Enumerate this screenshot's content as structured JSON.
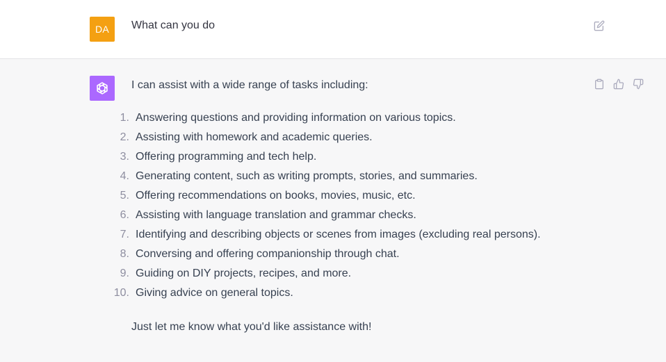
{
  "user_message": {
    "avatar_initials": "DA",
    "avatar_color": "#f4a012",
    "text": "What can you do",
    "edit_icon": "edit-icon"
  },
  "assistant_message": {
    "avatar_color": "#ab68ff",
    "avatar_icon": "openai-logo-icon",
    "intro": "I can assist with a wide range of tasks including:",
    "items": [
      {
        "number": "1.",
        "text": "Answering questions and providing information on various topics."
      },
      {
        "number": "2.",
        "text": "Assisting with homework and academic queries."
      },
      {
        "number": "3.",
        "text": "Offering programming and tech help."
      },
      {
        "number": "4.",
        "text": "Generating content, such as writing prompts, stories, and summaries."
      },
      {
        "number": "5.",
        "text": "Offering recommendations on books, movies, music, etc."
      },
      {
        "number": "6.",
        "text": "Assisting with language translation and grammar checks."
      },
      {
        "number": "7.",
        "text": "Identifying and describing objects or scenes from images (excluding real persons)."
      },
      {
        "number": "8.",
        "text": "Conversing and offering companionship through chat."
      },
      {
        "number": "9.",
        "text": "Guiding on DIY projects, recipes, and more."
      },
      {
        "number": "10.",
        "text": "Giving advice on general topics."
      }
    ],
    "outro": "Just let me know what you'd like assistance with!",
    "action_icons": [
      "clipboard-icon",
      "thumbs-up-icon",
      "thumbs-down-icon"
    ]
  }
}
